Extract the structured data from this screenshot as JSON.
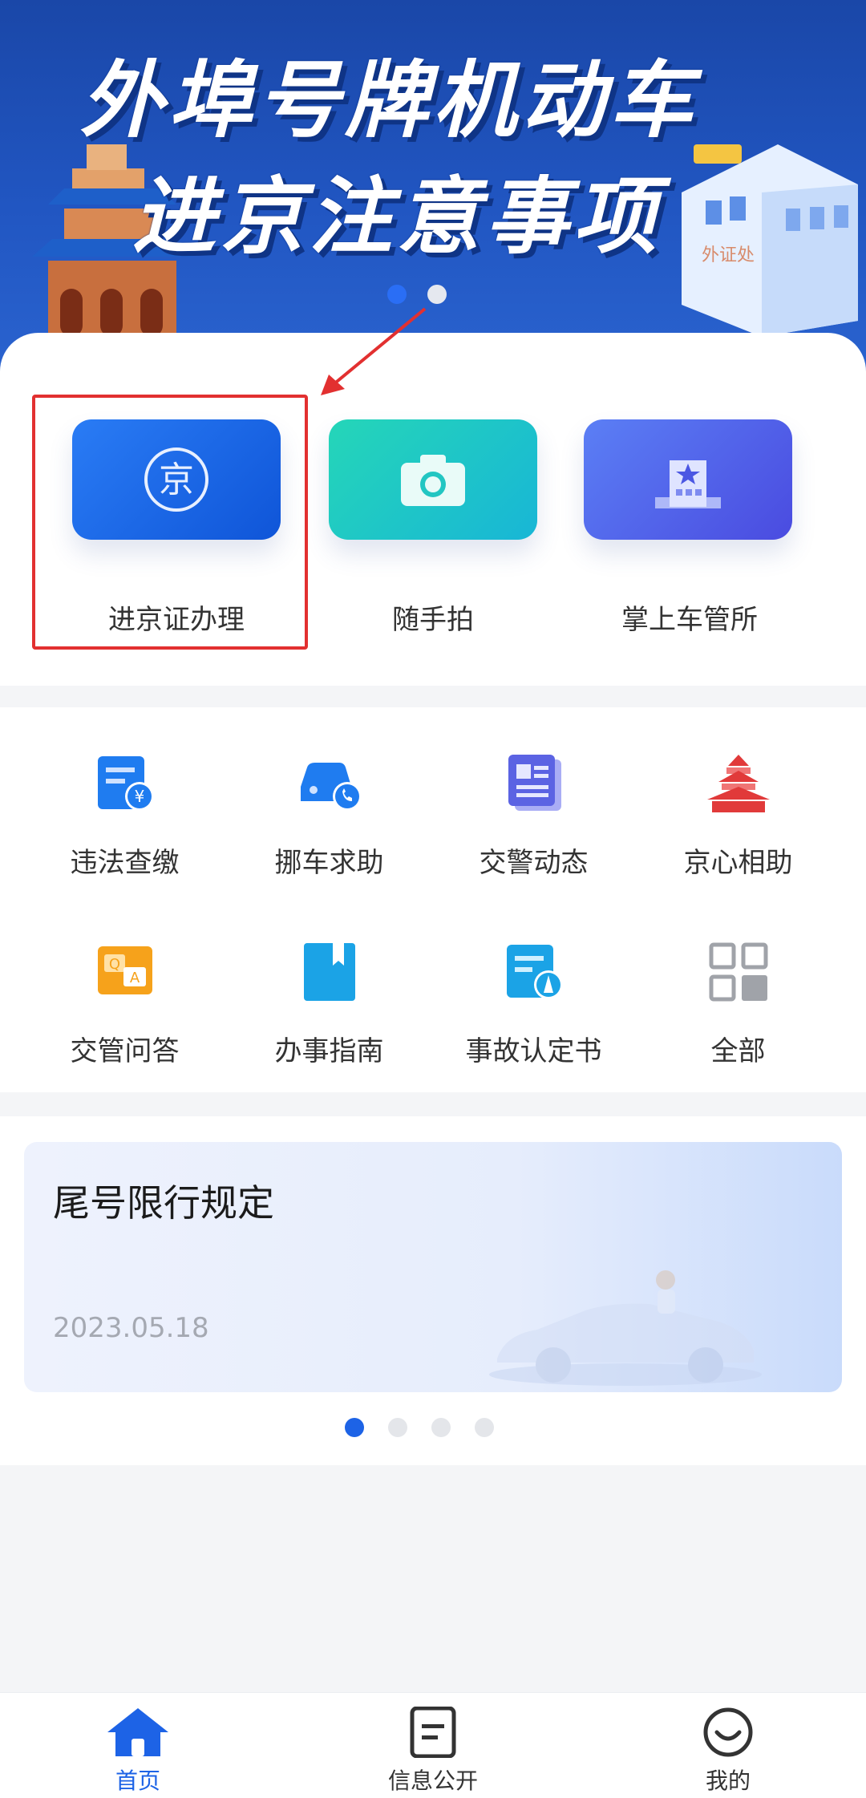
{
  "banner": {
    "title_line1": "外埠号牌机动车",
    "title_line2": "进京注意事项",
    "building_sign": "外证处",
    "dots": 2,
    "active_dot": 0
  },
  "quick_tiles": [
    {
      "label": "进京证办理",
      "icon": "jing-seal-icon",
      "highlighted": true
    },
    {
      "label": "随手拍",
      "icon": "camera-icon"
    },
    {
      "label": "掌上车管所",
      "icon": "office-building-icon"
    }
  ],
  "services": [
    {
      "label": "违法查缴",
      "icon": "fine-payment-icon"
    },
    {
      "label": "挪车求助",
      "icon": "car-call-icon"
    },
    {
      "label": "交警动态",
      "icon": "news-icon"
    },
    {
      "label": "京心相助",
      "icon": "tiantan-temple-icon"
    },
    {
      "label": "交管问答",
      "icon": "qa-icon"
    },
    {
      "label": "办事指南",
      "icon": "bookmark-guide-icon"
    },
    {
      "label": "事故认定书",
      "icon": "accident-doc-icon"
    },
    {
      "label": "全部",
      "icon": "grid-all-icon"
    }
  ],
  "notice": {
    "title": "尾号限行规定",
    "date": "2023.05.18",
    "page_count": 4,
    "active_page": 0
  },
  "bottom_nav": [
    {
      "label": "首页",
      "icon": "home-icon",
      "active": true
    },
    {
      "label": "信息公开",
      "icon": "document-icon",
      "active": false
    },
    {
      "label": "我的",
      "icon": "smiley-icon",
      "active": false
    }
  ],
  "colors": {
    "primary": "#1d63e6",
    "banner_bg": "#1f4fb4",
    "highlight": "#e23030"
  }
}
